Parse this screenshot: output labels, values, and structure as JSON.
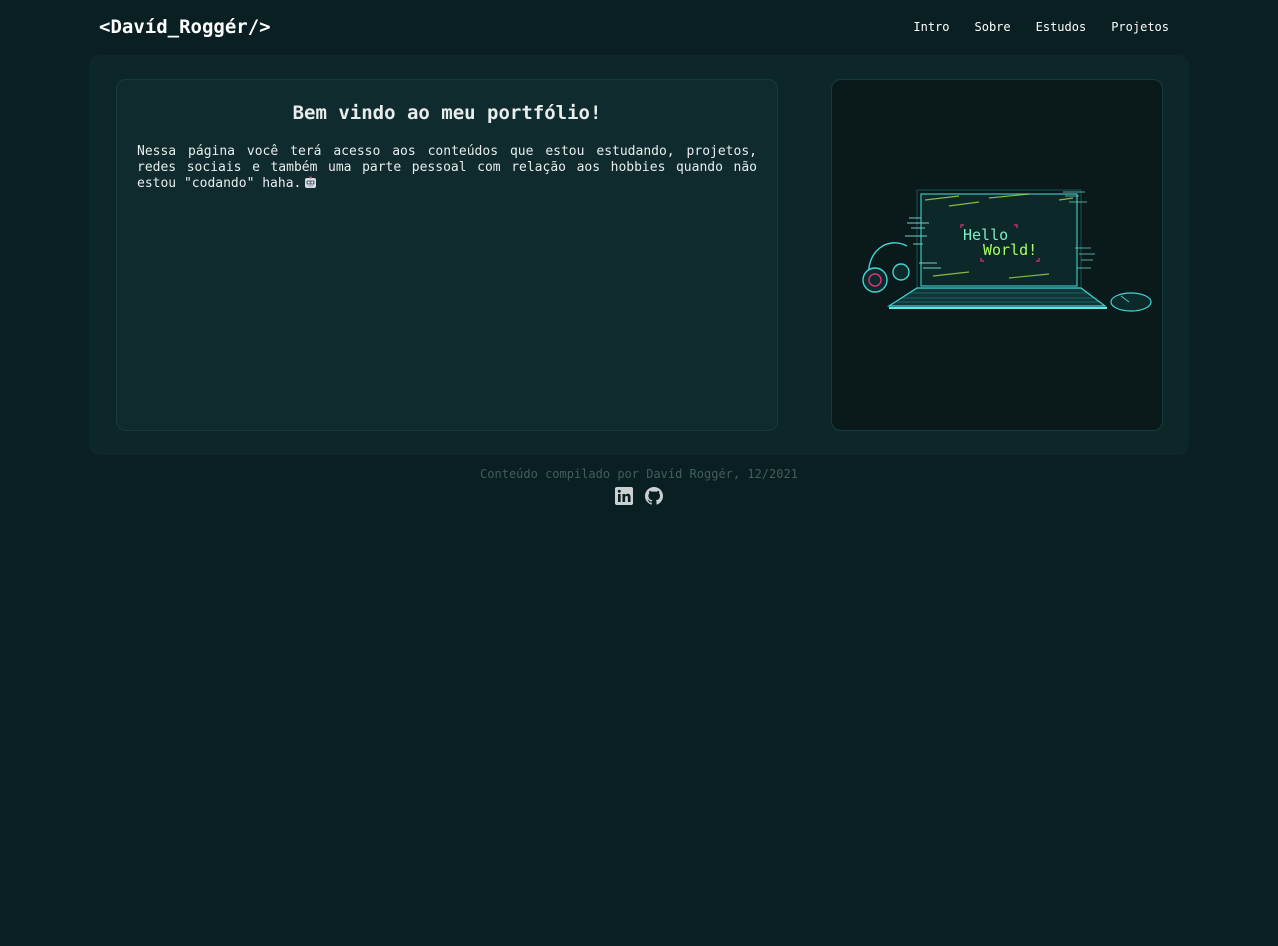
{
  "header": {
    "logo": "<Davíd_Roggér/>",
    "nav": [
      "Intro",
      "Sobre",
      "Estudos",
      "Projetos"
    ]
  },
  "intro": {
    "title": "Bem vindo ao meu portfólio!",
    "text": "Nessa página você terá acesso aos conteúdos que estou estudando, projetos, redes sociais e também uma parte pessoal com relação aos hobbies quando não estou \"codando\" haha."
  },
  "illustration": {
    "screen_text_line1": "Hello",
    "screen_text_line2": "World!"
  },
  "footer": {
    "credit": "Conteúdo compilado por Davíd Roggér, 12/2021",
    "social_icons": [
      "linkedin-icon",
      "github-icon"
    ]
  },
  "colors": {
    "background": "#0a1f21",
    "panel": "#0d2628",
    "card": "#0f2b2d",
    "image_card": "#0a191a",
    "footer_text": "#3f5f5c",
    "accent_cyan": "#3fd6d6",
    "accent_green": "#7cff6b"
  }
}
